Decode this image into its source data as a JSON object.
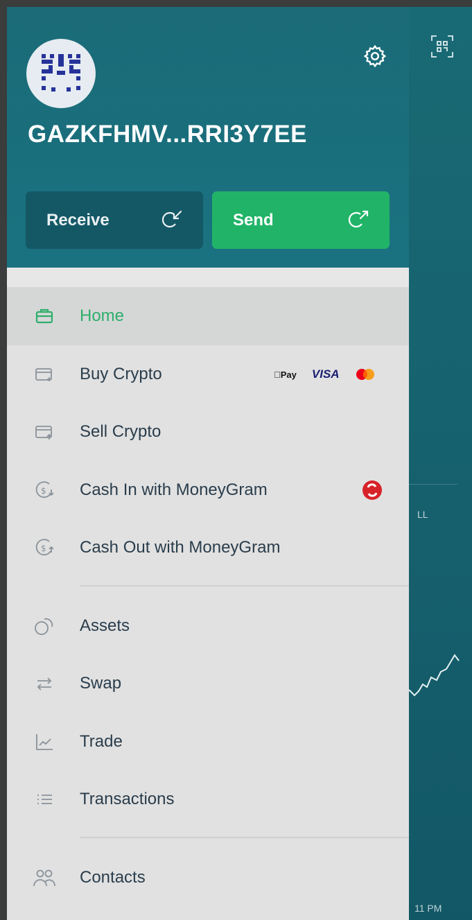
{
  "wallet": {
    "address_short": "GAZKFHMV...RRI3Y7EE"
  },
  "actions": {
    "receive_label": "Receive",
    "send_label": "Send"
  },
  "menu": {
    "items": [
      {
        "label": "Home",
        "icon": "wallet-icon",
        "active": true
      },
      {
        "label": "Buy Crypto",
        "icon": "card-in-icon"
      },
      {
        "label": "Sell Crypto",
        "icon": "card-out-icon"
      },
      {
        "label": "Cash In with MoneyGram",
        "icon": "cash-in-icon"
      },
      {
        "label": "Cash Out with MoneyGram",
        "icon": "cash-out-icon"
      },
      {
        "label": "Assets",
        "icon": "assets-icon"
      },
      {
        "label": "Swap",
        "icon": "swap-icon"
      },
      {
        "label": "Trade",
        "icon": "chart-icon"
      },
      {
        "label": "Transactions",
        "icon": "list-icon"
      },
      {
        "label": "Contacts",
        "icon": "contacts-icon"
      }
    ],
    "payment_logos": {
      "apple_pay": "Pay",
      "visa": "VISA",
      "mastercard": "mastercard-icon"
    }
  },
  "background": {
    "partial_label": "LL",
    "partial_time": "11 PM"
  },
  "colors": {
    "header": "#1b6b78",
    "send": "#21b468",
    "receive": "#145866",
    "active_text": "#2eae6c",
    "drawer_bg": "#e1e1e1"
  }
}
